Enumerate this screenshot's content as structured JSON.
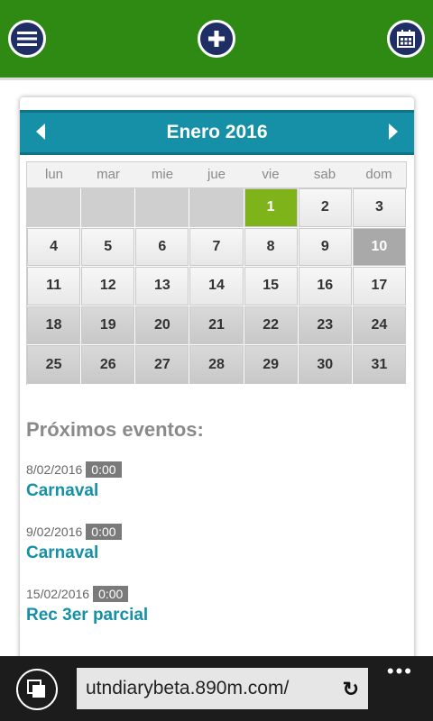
{
  "header": {
    "menu_icon": "hamburger-menu-icon",
    "add_icon": "plus-icon",
    "calendar_icon": "calendar-icon",
    "bg_color": "#2e8a12"
  },
  "calendar": {
    "title": "Enero 2016",
    "days_of_week": [
      "lun",
      "mar",
      "mie",
      "jue",
      "vie",
      "sab",
      "dom"
    ],
    "weeks": [
      [
        "",
        "",
        "",
        "",
        "1",
        "2",
        "3"
      ],
      [
        "4",
        "5",
        "6",
        "7",
        "8",
        "9",
        "10"
      ],
      [
        "11",
        "12",
        "13",
        "14",
        "15",
        "16",
        "17"
      ],
      [
        "18",
        "19",
        "20",
        "21",
        "22",
        "23",
        "24"
      ],
      [
        "25",
        "26",
        "27",
        "28",
        "29",
        "30",
        "31"
      ]
    ],
    "today": "1",
    "selected": "10",
    "accent_color": "#1590a6",
    "today_color": "#7fb31a"
  },
  "events": {
    "title": "Próximos eventos:",
    "items": [
      {
        "date": "8/02/2016",
        "time": "0:00",
        "name": "Carnaval"
      },
      {
        "date": "9/02/2016",
        "time": "0:00",
        "name": "Carnaval"
      },
      {
        "date": "15/02/2016",
        "time": "0:00",
        "name": "Rec 3er parcial"
      }
    ]
  },
  "browser": {
    "url": "utndiarybeta.890m.com/",
    "more": "•••",
    "refresh_icon": "refresh-icon",
    "tabs_icon": "tabs-icon"
  }
}
